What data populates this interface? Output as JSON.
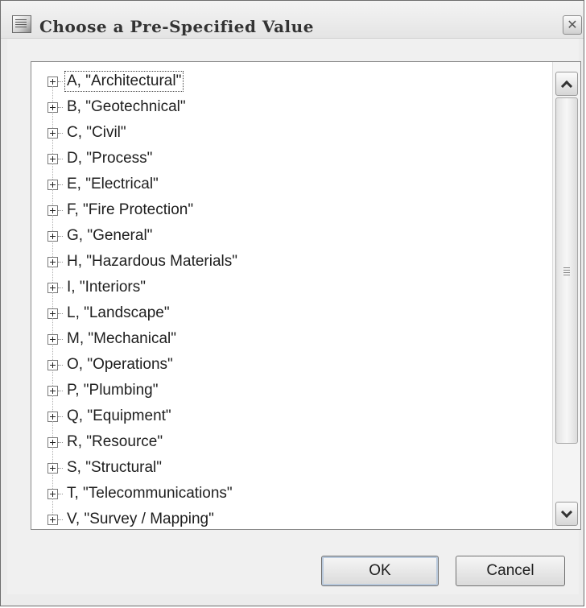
{
  "window": {
    "title": "Choose a Pre-Specified Value",
    "close_symbol": "✕"
  },
  "tree": {
    "selected_index": 0,
    "items": [
      {
        "label": "A, \"Architectural\""
      },
      {
        "label": "B, \"Geotechnical\""
      },
      {
        "label": "C, \"Civil\""
      },
      {
        "label": "D, \"Process\""
      },
      {
        "label": "E, \"Electrical\""
      },
      {
        "label": "F, \"Fire Protection\""
      },
      {
        "label": "G, \"General\""
      },
      {
        "label": "H, \"Hazardous Materials\""
      },
      {
        "label": "I, \"Interiors\""
      },
      {
        "label": "L, \"Landscape\""
      },
      {
        "label": "M, \"Mechanical\""
      },
      {
        "label": "O, \"Operations\""
      },
      {
        "label": "P, \"Plumbing\""
      },
      {
        "label": "Q, \"Equipment\""
      },
      {
        "label": "R, \"Resource\""
      },
      {
        "label": "S, \"Structural\""
      },
      {
        "label": "T, \"Telecommunications\""
      },
      {
        "label": "V, \"Survey / Mapping\""
      }
    ]
  },
  "buttons": {
    "ok_label": "OK",
    "cancel_label": "Cancel"
  },
  "icons": {
    "app": "window-app-icon",
    "close": "close-icon",
    "expand": "plus-expand-icon",
    "scroll_up": "chevron-up-icon",
    "scroll_down": "chevron-down-icon"
  }
}
